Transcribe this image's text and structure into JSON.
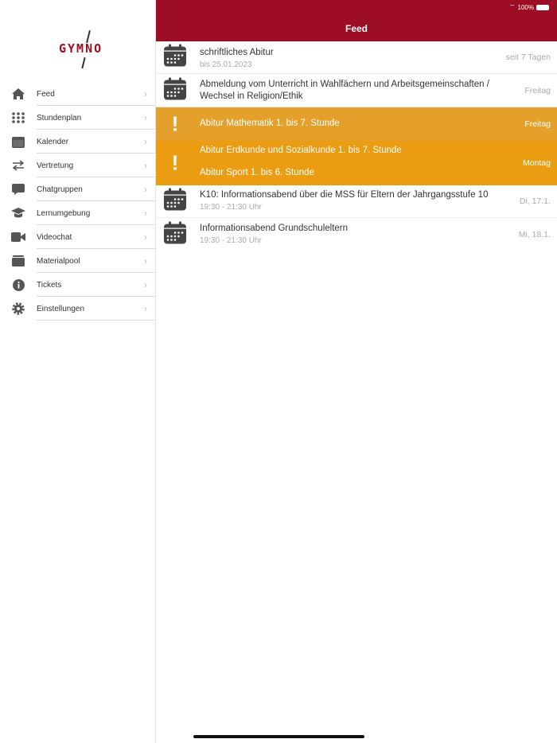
{
  "logo": {
    "text": "GYMNO"
  },
  "sidebar": {
    "items": [
      {
        "label": "Feed",
        "icon": "home-icon"
      },
      {
        "label": "Stundenplan",
        "icon": "grid-icon"
      },
      {
        "label": "Kalender",
        "icon": "calendar-icon"
      },
      {
        "label": "Vertretung",
        "icon": "swap-icon"
      },
      {
        "label": "Chatgruppen",
        "icon": "chat-icon"
      },
      {
        "label": "Lernumgebung",
        "icon": "graduation-cap-icon"
      },
      {
        "label": "Videochat",
        "icon": "video-icon"
      },
      {
        "label": "Materialpool",
        "icon": "box-icon"
      },
      {
        "label": "Tickets",
        "icon": "info-icon"
      },
      {
        "label": "Einstellungen",
        "icon": "gear-icon"
      }
    ]
  },
  "status": {
    "battery": "100%"
  },
  "header": {
    "title": "Feed"
  },
  "colors": {
    "header": "#9d0e25",
    "warn1": "#e4a02a",
    "warn2": "#ea9c12"
  },
  "feed": [
    {
      "title": "schriftliches Abitur",
      "sub": "bis 25.01.2023",
      "date": "seit 7 Tagen"
    },
    {
      "title": "Abmeldung vom Unterricht in Wahlfächern und Arbeitsgemeinschaften / Wechsel in Religion/Ethik",
      "date": "Freitag"
    },
    {
      "title": "Abitur Mathematik 1. bis 7. Stunde",
      "date": "Freitag"
    },
    {
      "title": "Abitur Erdkunde und Sozialkunde 1. bis 7. Stunde",
      "title2": "Abitur Sport 1. bis 6. Stunde",
      "date": "Montag"
    },
    {
      "title": "K10: Informationsabend über die MSS für Eltern der Jahrgangsstufe 10",
      "sub": "19:30 - 21:30 Uhr",
      "date": "Di, 17.1."
    },
    {
      "title": "Informationsabend Grundschuleltern",
      "sub": "19:30 - 21:30 Uhr",
      "date": "Mi, 18.1."
    }
  ]
}
